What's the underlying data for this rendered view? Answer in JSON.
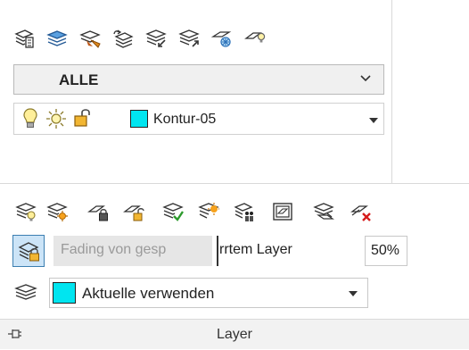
{
  "top_toolbar": {
    "icons": [
      "layer-properties-icon",
      "layer-states-icon",
      "make-object-layer-current-icon",
      "previous-layer-icon",
      "match-layer-icon",
      "change-to-current-layer-icon",
      "layer-freeze-settings-icon",
      "layer-light-icon"
    ]
  },
  "layer_state_combo": {
    "value": "ALLE"
  },
  "layer_row": {
    "name": "Kontur-05",
    "color": "#00e5f0"
  },
  "bottom_toolbar": {
    "icons": [
      "isolate-layer-icon",
      "unisolate-layer-icon",
      "lock-layer-icon",
      "unlock-layer-icon",
      "layer-match-check-icon",
      "layer-walk-icon",
      "merge-layer-icon",
      "viewport-icon",
      "copy-to-layer-icon",
      "delete-layer-icon"
    ]
  },
  "fading": {
    "field_text": "Fading von gesp",
    "field_rest": "rrtem Layer",
    "percent": "50%"
  },
  "color_combo": {
    "value": "Aktuelle verwenden",
    "color": "#00e5f0"
  },
  "footer": {
    "title": "Layer"
  }
}
